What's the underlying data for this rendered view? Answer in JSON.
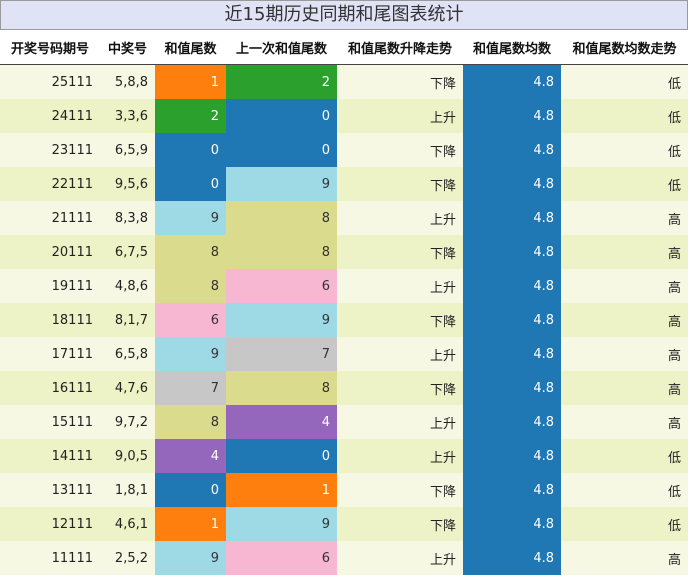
{
  "title": "近15期历史同期和尾图表统计",
  "headers": [
    "开奖号码期号",
    "中奖号",
    "和值尾数",
    "上一次和值尾数",
    "和值尾数升降走势",
    "和值尾数均数",
    "和值尾数均数走势"
  ],
  "colors": {
    "0": "#1f77b4",
    "1": "#ff7f0e",
    "2": "#2ca02c",
    "4": "#9467bd",
    "6": "#f7b6d2",
    "7": "#c7c7c7",
    "8": "#dbdb8d",
    "9": "#9edae5",
    "avg": "#1f77b4"
  },
  "rows": [
    {
      "period": "25111",
      "numbers": "5,8,8",
      "tail": "1",
      "prev_tail": "2",
      "trend": "下降",
      "avg": "4.8",
      "avg_trend": "低"
    },
    {
      "period": "24111",
      "numbers": "3,3,6",
      "tail": "2",
      "prev_tail": "0",
      "trend": "上升",
      "avg": "4.8",
      "avg_trend": "低"
    },
    {
      "period": "23111",
      "numbers": "6,5,9",
      "tail": "0",
      "prev_tail": "0",
      "trend": "下降",
      "avg": "4.8",
      "avg_trend": "低"
    },
    {
      "period": "22111",
      "numbers": "9,5,6",
      "tail": "0",
      "prev_tail": "9",
      "trend": "下降",
      "avg": "4.8",
      "avg_trend": "低"
    },
    {
      "period": "21111",
      "numbers": "8,3,8",
      "tail": "9",
      "prev_tail": "8",
      "trend": "上升",
      "avg": "4.8",
      "avg_trend": "高"
    },
    {
      "period": "20111",
      "numbers": "6,7,5",
      "tail": "8",
      "prev_tail": "8",
      "trend": "下降",
      "avg": "4.8",
      "avg_trend": "高"
    },
    {
      "period": "19111",
      "numbers": "4,8,6",
      "tail": "8",
      "prev_tail": "6",
      "trend": "上升",
      "avg": "4.8",
      "avg_trend": "高"
    },
    {
      "period": "18111",
      "numbers": "8,1,7",
      "tail": "6",
      "prev_tail": "9",
      "trend": "下降",
      "avg": "4.8",
      "avg_trend": "高"
    },
    {
      "period": "17111",
      "numbers": "6,5,8",
      "tail": "9",
      "prev_tail": "7",
      "trend": "上升",
      "avg": "4.8",
      "avg_trend": "高"
    },
    {
      "period": "16111",
      "numbers": "4,7,6",
      "tail": "7",
      "prev_tail": "8",
      "trend": "下降",
      "avg": "4.8",
      "avg_trend": "高"
    },
    {
      "period": "15111",
      "numbers": "9,7,2",
      "tail": "8",
      "prev_tail": "4",
      "trend": "上升",
      "avg": "4.8",
      "avg_trend": "高"
    },
    {
      "period": "14111",
      "numbers": "9,0,5",
      "tail": "4",
      "prev_tail": "0",
      "trend": "上升",
      "avg": "4.8",
      "avg_trend": "低"
    },
    {
      "period": "13111",
      "numbers": "1,8,1",
      "tail": "0",
      "prev_tail": "1",
      "trend": "下降",
      "avg": "4.8",
      "avg_trend": "低"
    },
    {
      "period": "12111",
      "numbers": "4,6,1",
      "tail": "1",
      "prev_tail": "9",
      "trend": "下降",
      "avg": "4.8",
      "avg_trend": "低"
    },
    {
      "period": "11111",
      "numbers": "2,5,2",
      "tail": "9",
      "prev_tail": "6",
      "trend": "上升",
      "avg": "4.8",
      "avg_trend": "高"
    }
  ]
}
